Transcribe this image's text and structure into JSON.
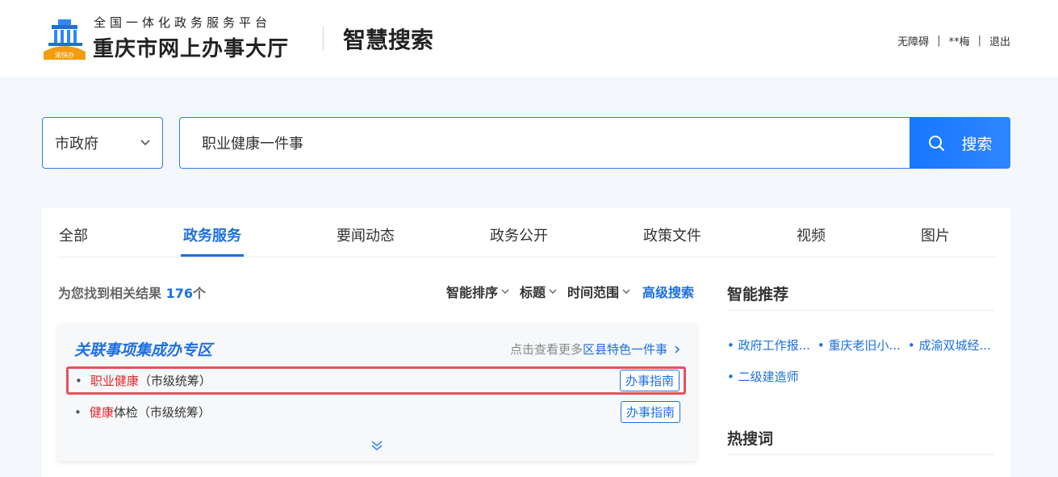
{
  "header": {
    "platform_subtitle": "全国一体化政务服务平台",
    "hall_name": "重庆市网上办事大厅",
    "logo_badge_text": "渝快办",
    "page_title": "智慧搜索",
    "user_nav": {
      "accessibility": "无障碍",
      "separator": "|",
      "username": "**梅",
      "logout": "退出"
    }
  },
  "search": {
    "scope_value": "市政府",
    "query": "职业健康一件事",
    "button_label": "搜索"
  },
  "tabs": [
    "全部",
    "政务服务",
    "要闻动态",
    "政务公开",
    "政策文件",
    "视频",
    "图片"
  ],
  "active_tab": "政务服务",
  "results": {
    "count_prefix": "为您找到相关结果",
    "count": "176",
    "count_suffix": "个"
  },
  "filters": {
    "sort": "智能排序",
    "title": "标题",
    "time_range": "时间范围",
    "advanced": "高级搜索"
  },
  "related_zone": {
    "title": "关联事项集成办专区",
    "more_prefix": "点击查看更多",
    "more_link": "区县特色一件事",
    "items": [
      {
        "bullet": "•",
        "highlight": "职业健康",
        "rest": "（市级统筹）",
        "button": "办事指南"
      },
      {
        "bullet": "•",
        "highlight": "健康",
        "rest": "体检（市级统筹）",
        "button": "办事指南"
      }
    ]
  },
  "sidebar": {
    "recommend_title": "智能推荐",
    "recommendations": [
      "• 政府工作报...",
      "• 重庆老旧小...",
      "• 成渝双城经...",
      "• 二级建造师"
    ],
    "hot_title": "热搜词"
  },
  "colors": {
    "accent": "#1d6fe0",
    "highlight_text": "#e5252b",
    "highlight_border": "#e8505b",
    "page_bg": "#f4f8fc"
  }
}
